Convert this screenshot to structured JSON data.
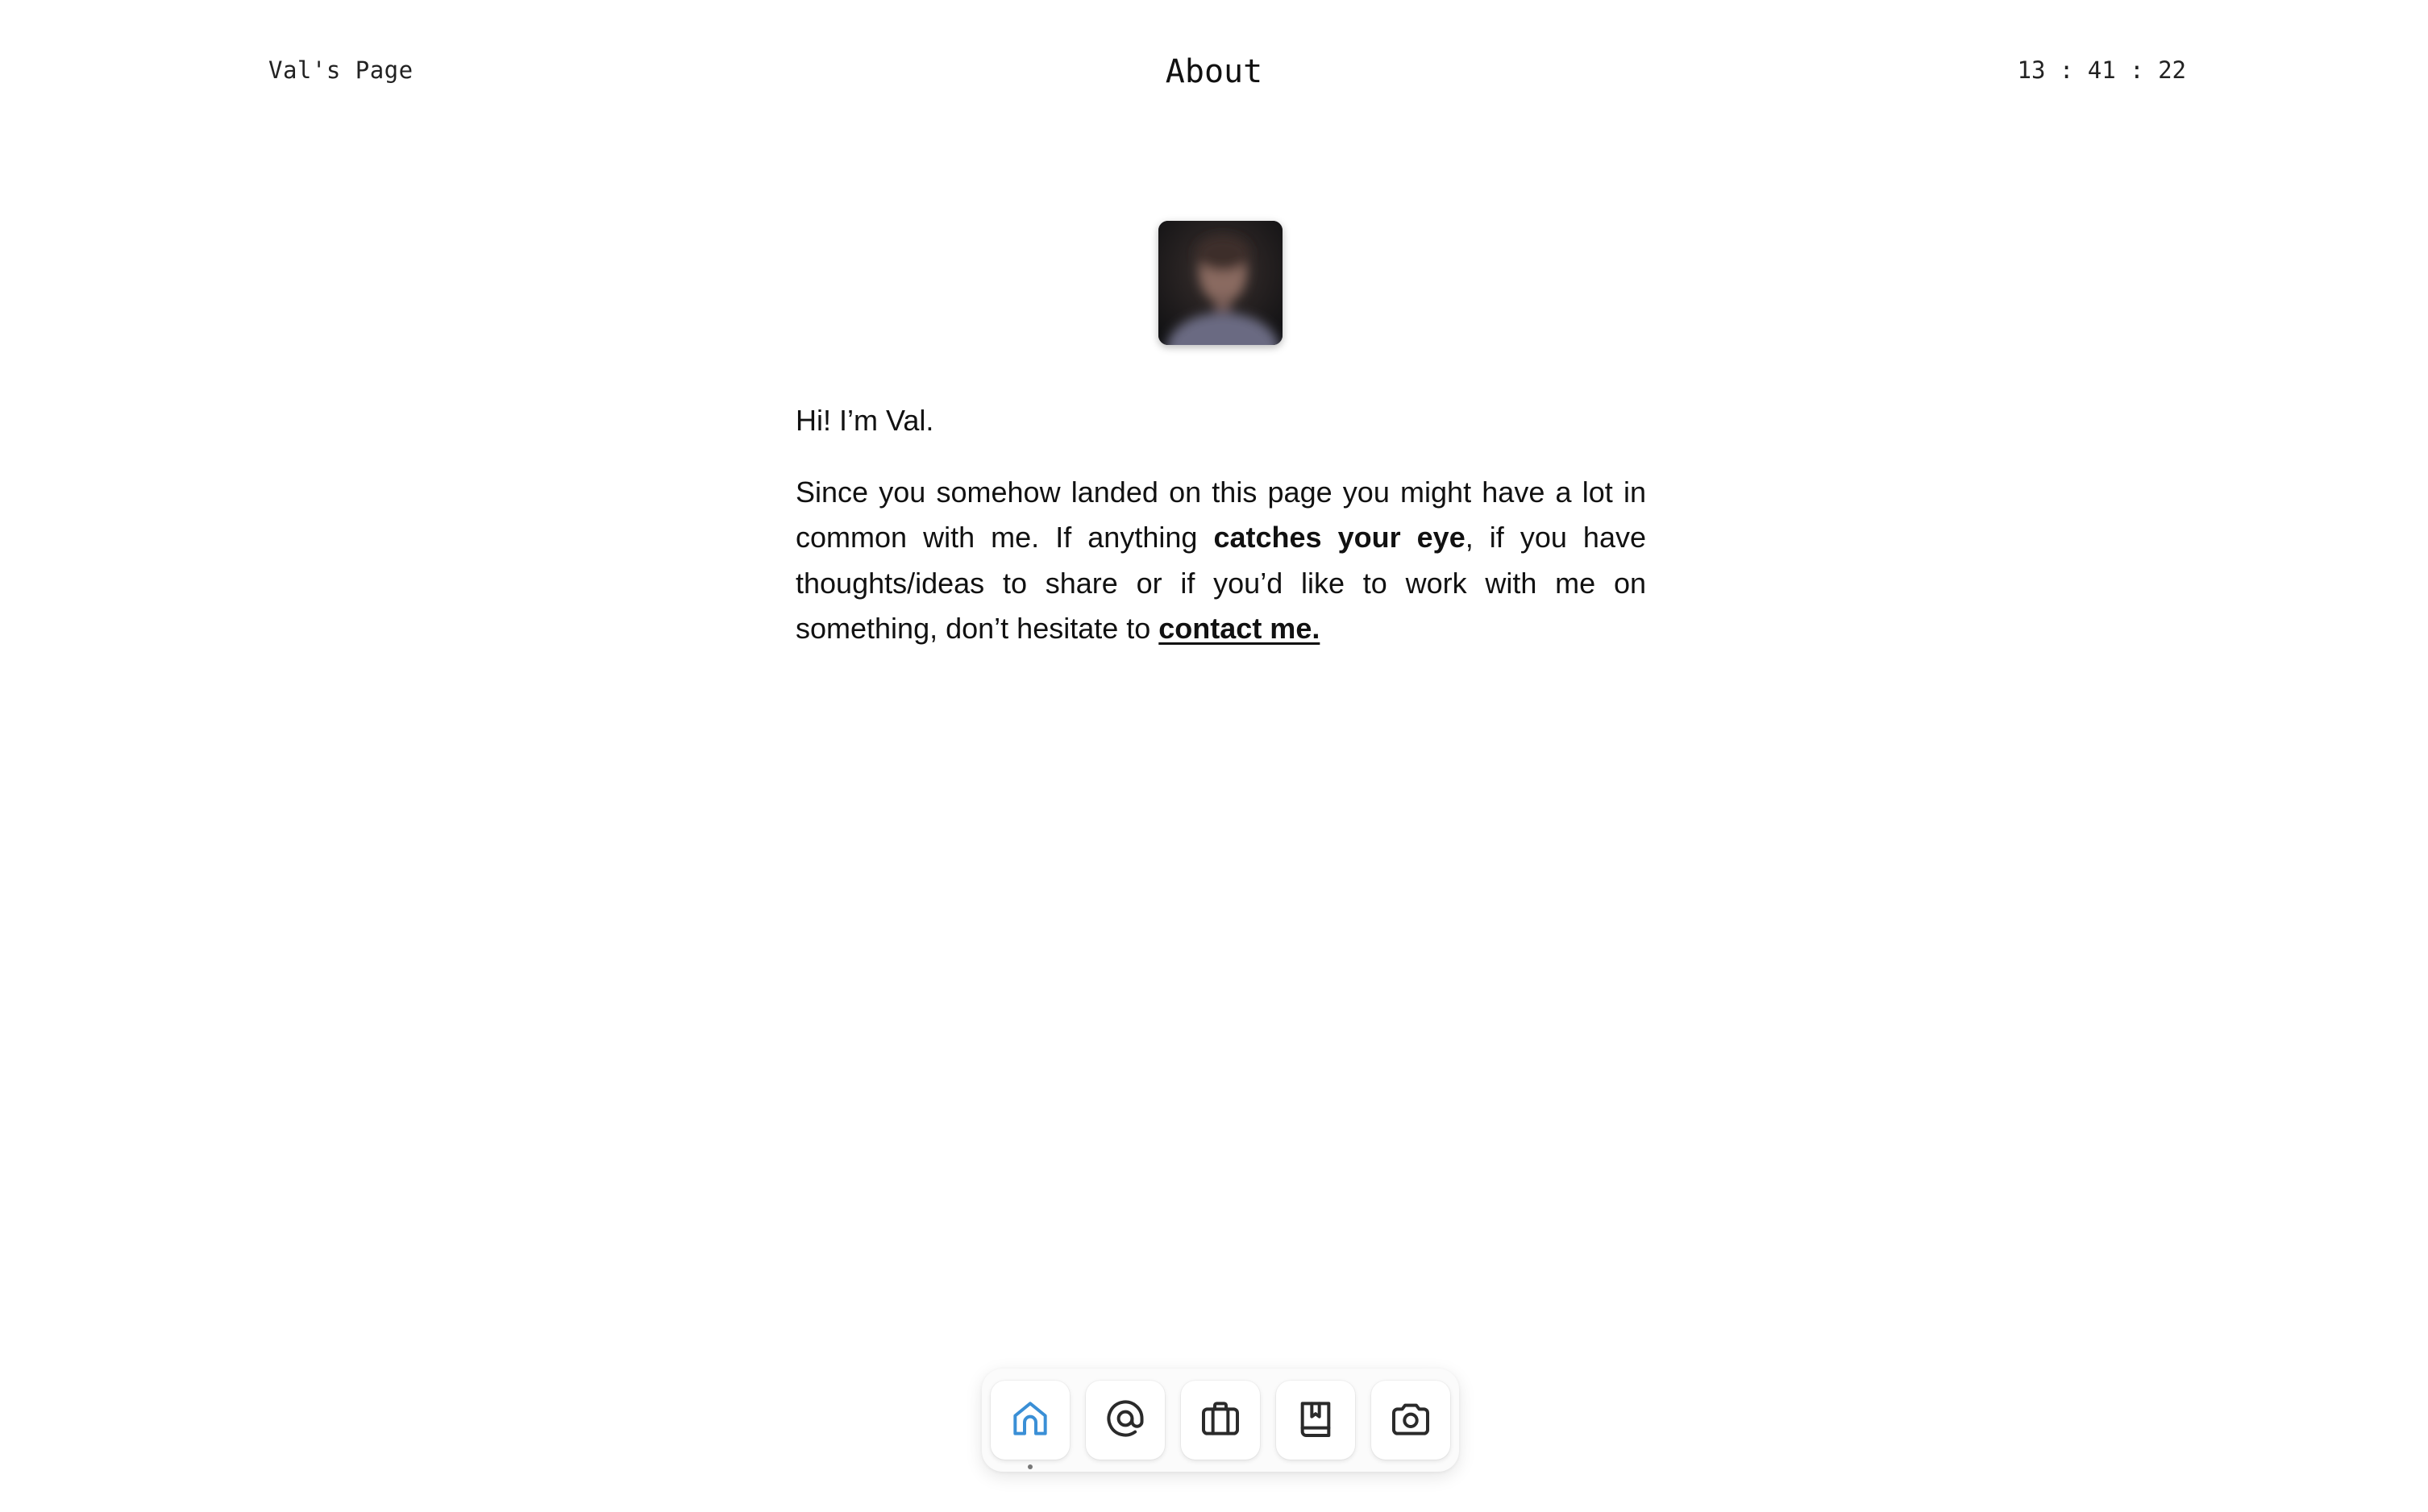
{
  "header": {
    "site_name": "Val's Page",
    "title": "About",
    "clock": "13 : 41 : 22"
  },
  "profile": {
    "avatar_icon": "profile-photo"
  },
  "about": {
    "greeting": "Hi! I’m Val.",
    "paragraph": {
      "part1": "Since you somehow landed on this page you might have a lot in common with me. If anything ",
      "highlight": "catches your eye",
      "part2": ", if you have thoughts/ideas to share or if you’d like to work with me on something, don’t hesitate to ",
      "link_text": "contact me."
    }
  },
  "dock": {
    "items": [
      {
        "icon": "home-icon",
        "active": true
      },
      {
        "icon": "at-sign-icon",
        "active": false
      },
      {
        "icon": "briefcase-icon",
        "active": false
      },
      {
        "icon": "bookmark-book-icon",
        "active": false
      },
      {
        "icon": "camera-icon",
        "active": false
      }
    ]
  },
  "colors": {
    "active_icon": "#3a8fd6",
    "icon": "#2a2a2a",
    "text": "#111111",
    "background": "#ffffff"
  }
}
